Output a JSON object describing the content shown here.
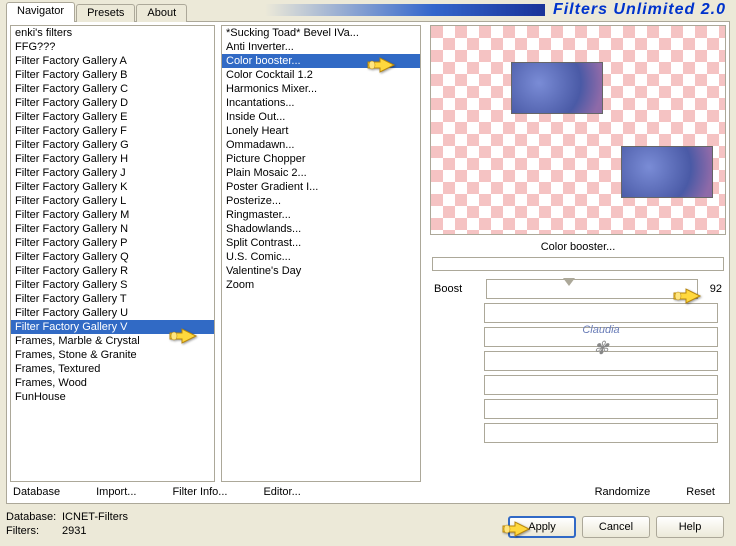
{
  "app_title": "Filters Unlimited 2.0",
  "tabs": {
    "navigator": "Navigator",
    "presets": "Presets",
    "about": "About"
  },
  "categories": [
    "enki's filters",
    "FFG???",
    "Filter Factory Gallery A",
    "Filter Factory Gallery B",
    "Filter Factory Gallery C",
    "Filter Factory Gallery D",
    "Filter Factory Gallery E",
    "Filter Factory Gallery F",
    "Filter Factory Gallery G",
    "Filter Factory Gallery H",
    "Filter Factory Gallery J",
    "Filter Factory Gallery K",
    "Filter Factory Gallery L",
    "Filter Factory Gallery M",
    "Filter Factory Gallery N",
    "Filter Factory Gallery P",
    "Filter Factory Gallery Q",
    "Filter Factory Gallery R",
    "Filter Factory Gallery S",
    "Filter Factory Gallery T",
    "Filter Factory Gallery U",
    "Filter Factory Gallery V",
    "Frames, Marble & Crystal",
    "Frames, Stone & Granite",
    "Frames, Textured",
    "Frames, Wood",
    "FunHouse"
  ],
  "selected_category_index": 21,
  "filters": [
    "*Sucking Toad*  Bevel IVa...",
    "Anti Inverter...",
    "Color booster...",
    "Color Cocktail 1.2",
    "Harmonics Mixer...",
    "Incantations...",
    "Inside Out...",
    "Lonely Heart",
    "Ommadawn...",
    "Picture Chopper",
    "Plain Mosaic 2...",
    "Poster Gradient I...",
    "Posterize...",
    "Ringmaster...",
    "Shadowlands...",
    "Split Contrast...",
    "U.S. Comic...",
    "Valentine's Day",
    "Zoom"
  ],
  "selected_filter_index": 2,
  "current_filter_name": "Color booster...",
  "slider": {
    "label": "Boost",
    "value": "92",
    "percent": 36
  },
  "toolbar": {
    "database": "Database",
    "import": "Import...",
    "filter_info": "Filter Info...",
    "editor": "Editor...",
    "randomize": "Randomize",
    "reset": "Reset"
  },
  "footer": {
    "db_label": "Database:",
    "db_value": "ICNET-Filters",
    "filters_label": "Filters:",
    "filters_value": "2931"
  },
  "buttons": {
    "apply": "Apply",
    "cancel": "Cancel",
    "help": "Help"
  },
  "watermark": "Claudia"
}
